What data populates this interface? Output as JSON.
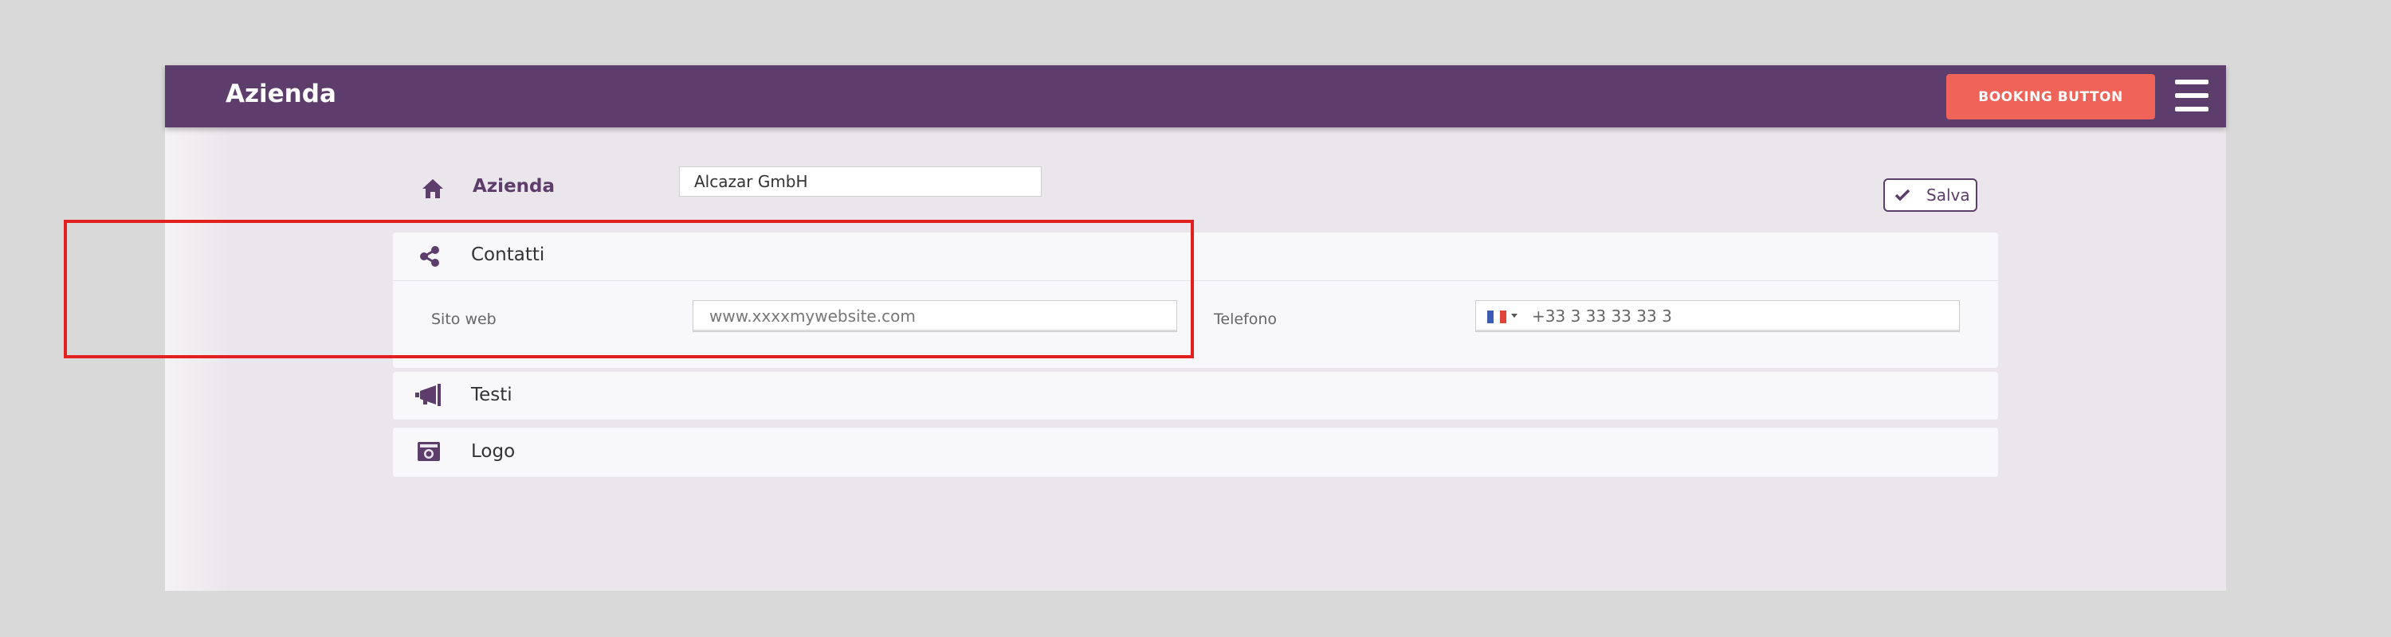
{
  "header": {
    "title": "Azienda",
    "booking_button": "BOOKING BUTTON",
    "accent_color": "#5c3d6b",
    "button_color": "#ef6358"
  },
  "company_row": {
    "label": "Azienda",
    "icon": "home-icon",
    "value": "Alcazar GmbH"
  },
  "save_button": {
    "label": "Salva",
    "icon": "check-icon"
  },
  "sections": [
    {
      "label": "Contatti",
      "icon": "share-icon",
      "fields": {
        "website_label": "Sito web",
        "website_placeholder": "www.xxxxmywebsite.com",
        "phone_label": "Telefono",
        "phone_value": "+33 3 33 33 33 3",
        "phone_flag": "france-flag-icon"
      }
    },
    {
      "label": "Testi",
      "icon": "megaphone-icon"
    },
    {
      "label": "Logo",
      "icon": "camera-icon"
    }
  ],
  "highlight_color": "#e32020"
}
